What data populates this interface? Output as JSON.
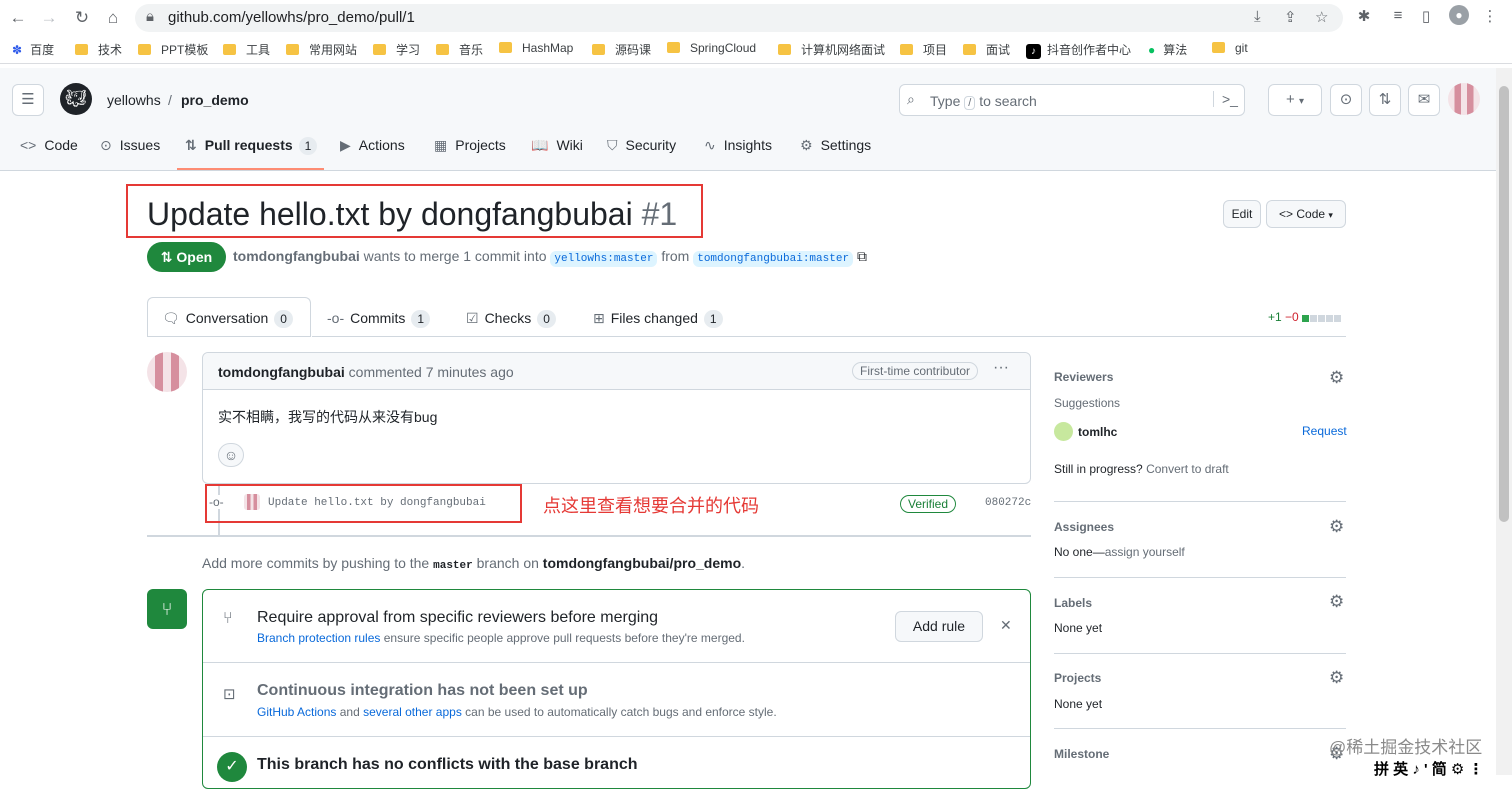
{
  "browser": {
    "url": "github.com/yellowhs/pro_demo/pull/1",
    "bookmarks": [
      "百度",
      "技术",
      "PPT模板",
      "工具",
      "常用网站",
      "学习",
      "音乐",
      "HashMap",
      "源码课",
      "SpringCloud",
      "计算机网络面试",
      "项目",
      "面试",
      "抖音创作者中心",
      "算法",
      "git"
    ]
  },
  "header": {
    "owner": "yellowhs",
    "separator": "/",
    "repo": "pro_demo",
    "search_prefix": "Type",
    "search_key": "/",
    "search_suffix": "to search",
    "plus": "+"
  },
  "repo_tabs": [
    {
      "label": "Code",
      "icon": "<>"
    },
    {
      "label": "Issues",
      "icon": "⊙"
    },
    {
      "label": "Pull requests",
      "icon": "⇅",
      "count": "1"
    },
    {
      "label": "Actions",
      "icon": "▶"
    },
    {
      "label": "Projects",
      "icon": "▦"
    },
    {
      "label": "Wiki",
      "icon": "📖"
    },
    {
      "label": "Security",
      "icon": "⛉"
    },
    {
      "label": "Insights",
      "icon": "∿"
    },
    {
      "label": "Settings",
      "icon": "⚙"
    }
  ],
  "pr": {
    "title": "Update hello.txt by dongfangbubai",
    "number": "#1",
    "state": "Open",
    "author": "tomdongfangbubai",
    "merge_text": "wants to merge 1 commit into",
    "base_branch": "yellowhs:master",
    "from_text": "from",
    "head_branch": "tomdongfangbubai:master",
    "edit_label": "Edit",
    "code_label": "Code"
  },
  "pr_tabs": [
    {
      "label": "Conversation",
      "count": "0"
    },
    {
      "label": "Commits",
      "count": "1"
    },
    {
      "label": "Checks",
      "count": "0"
    },
    {
      "label": "Files changed",
      "count": "1"
    }
  ],
  "diffstat": {
    "added": "+1",
    "removed": "−0"
  },
  "comment": {
    "author": "tomdongfangbubai",
    "meta": "commented 7 minutes ago",
    "badge": "First-time contributor",
    "body": "实不相瞒，我写的代码从来没有bug",
    "more": "···"
  },
  "commit": {
    "message": "Update hello.txt by dongfangbubai",
    "verified": "Verified",
    "sha": "080272c"
  },
  "annotation": "点这里查看想要合并的代码",
  "push_hint": {
    "prefix": "Add more commits by pushing to the",
    "branch": "master",
    "middle": "branch on",
    "repo": "tomdongfangbubai/pro_demo",
    "suffix": "."
  },
  "merge_box": {
    "rule_title": "Require approval from specific reviewers before merging",
    "rule_link": "Branch protection rules",
    "rule_desc": "ensure specific people approve pull requests before they're merged.",
    "add_rule": "Add rule",
    "ci_title": "Continuous integration has not been set up",
    "ci_link1": "GitHub Actions",
    "ci_and": "and",
    "ci_link2": "several other apps",
    "ci_desc": "can be used to automatically catch bugs and enforce style.",
    "conflict_title": "This branch has no conflicts with the base branch"
  },
  "sidebar": {
    "reviewers_label": "Reviewers",
    "suggestions_label": "Suggestions",
    "suggested_user": "tomlhc",
    "request_label": "Request",
    "progress_text": "Still in progress?",
    "draft_link": "Convert to draft",
    "assignees_label": "Assignees",
    "assignees_value": "No one—",
    "assign_link": "assign yourself",
    "labels_label": "Labels",
    "labels_value": "None yet",
    "projects_label": "Projects",
    "projects_value": "None yet",
    "milestone_label": "Milestone"
  },
  "watermark": "@稀土掘金技术社区",
  "ime": "拼 英 ♪ ' 简 ⚙ ⋮",
  "colors": {
    "open_green": "#1f883d",
    "accent_red": "#e53935",
    "link_blue": "#0969da",
    "tab_underline": "#fd8c73"
  }
}
